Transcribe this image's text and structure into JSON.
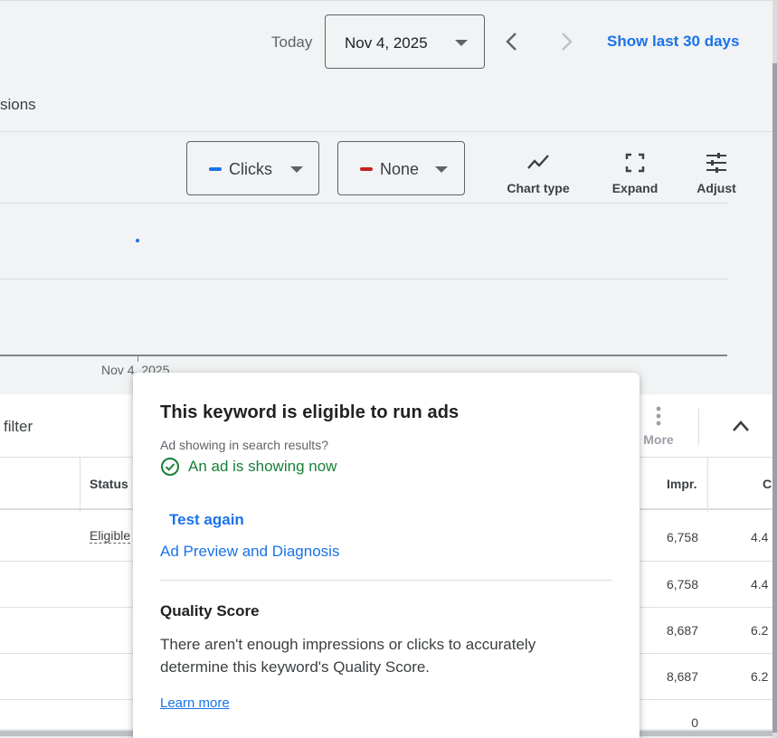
{
  "header": {
    "today_label": "Today",
    "date_value": "Nov 4, 2025",
    "show_last_label": "Show last 30 days"
  },
  "subrow": {
    "label": "sions"
  },
  "chart_controls": {
    "metric1": {
      "label": "Clicks",
      "color": "#1a73e8"
    },
    "metric2": {
      "label": "None",
      "color": "#c5221f"
    },
    "tools": [
      {
        "label": "Chart type",
        "icon": "chart-type-icon"
      },
      {
        "label": "Expand",
        "icon": "expand-icon"
      },
      {
        "label": "Adjust",
        "icon": "adjust-icon"
      }
    ]
  },
  "chart_data": {
    "type": "scatter",
    "x": [
      "Nov 4, 2025"
    ],
    "series": [
      {
        "values": [
          null
        ],
        "color": "#1a73e8"
      }
    ],
    "xlabel": "",
    "ylabel": "",
    "grid": true,
    "tick_labels": [
      "Nov 4, 2025"
    ]
  },
  "table": {
    "filter_label": "filter",
    "more_label": "More",
    "headers": {
      "status": "Status",
      "impr": "Impr.",
      "next": "C"
    },
    "rows": [
      {
        "status": "Eligible",
        "impr": "6,758",
        "next": "4.4"
      },
      {
        "status": "",
        "impr": "6,758",
        "next": "4.4"
      },
      {
        "status": "",
        "impr": "8,687",
        "next": "6.2"
      },
      {
        "status": "",
        "impr": "8,687",
        "next": "6.2"
      },
      {
        "status": "",
        "impr": "0",
        "next": ""
      }
    ]
  },
  "popup": {
    "title": "This keyword is eligible to run ads",
    "question": "Ad showing in search results?",
    "status": "An ad is showing now",
    "test_again": "Test again",
    "ad_preview": "Ad Preview and Diagnosis",
    "qs_title": "Quality Score",
    "qs_desc": "There aren't enough impressions or clicks to accurately determine this keyword's Quality Score.",
    "learn_more": "Learn more",
    "status_color": "#188038",
    "link_color": "#1a73e8"
  }
}
